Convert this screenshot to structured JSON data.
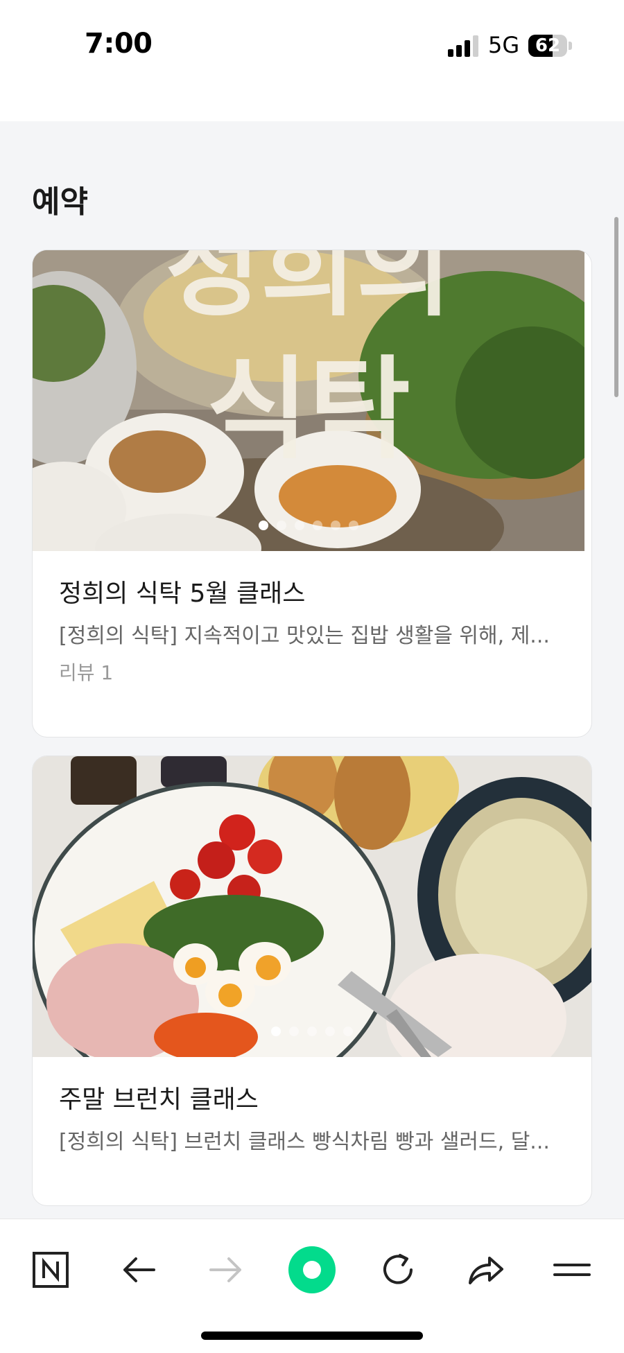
{
  "status_bar": {
    "time": "7:00",
    "network": "5G",
    "battery": "62",
    "battery_level": 0.62
  },
  "page": {
    "section_title": "예약"
  },
  "cards": [
    {
      "title": "정희의 식탁 5월 클래스",
      "description": "[정희의 식탁] 지속적이고 맛있는 집밥 생활을 위해, 제...",
      "review": "리뷰 1",
      "image_overlay_text": "정희의 식탁",
      "dots_total": 6,
      "dots_active": 1
    },
    {
      "title": "주말 브런치 클래스",
      "description": "[정희의 식탁] 브런치 클래스 빵식차림 빵과 샐러드, 달...",
      "dots_total": 5,
      "dots_active": 1
    }
  ],
  "toolbar": {
    "items": [
      "naver-home-icon",
      "back-arrow-icon",
      "forward-arrow-icon",
      "naver-green-dot-icon",
      "refresh-icon",
      "share-icon",
      "menu-icon"
    ],
    "accent": "#03db8c"
  }
}
